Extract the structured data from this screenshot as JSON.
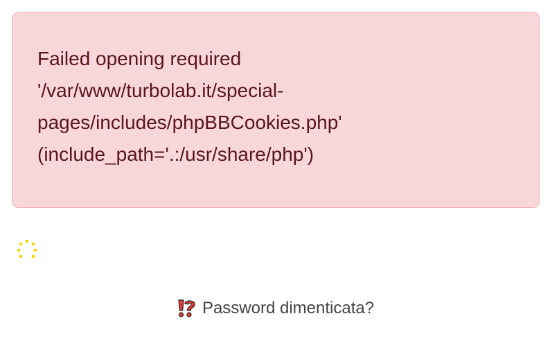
{
  "alert": {
    "message": "Failed opening required\n'/var/www/turbolab.it/special-\npages/includes/phpBBCookies.php'\n(include_path='.:/usr/share/php')"
  },
  "loading": {
    "icon": "loading-spinner-icon",
    "color": "#f4d400"
  },
  "forgot_password": {
    "icon": "exclamation-question-icon",
    "label": "Password dimenticata?"
  },
  "colors": {
    "alert_background": "#f8d7da",
    "alert_border": "#f1aeb5",
    "alert_text": "#58151c",
    "icon_red": "#e53935"
  }
}
